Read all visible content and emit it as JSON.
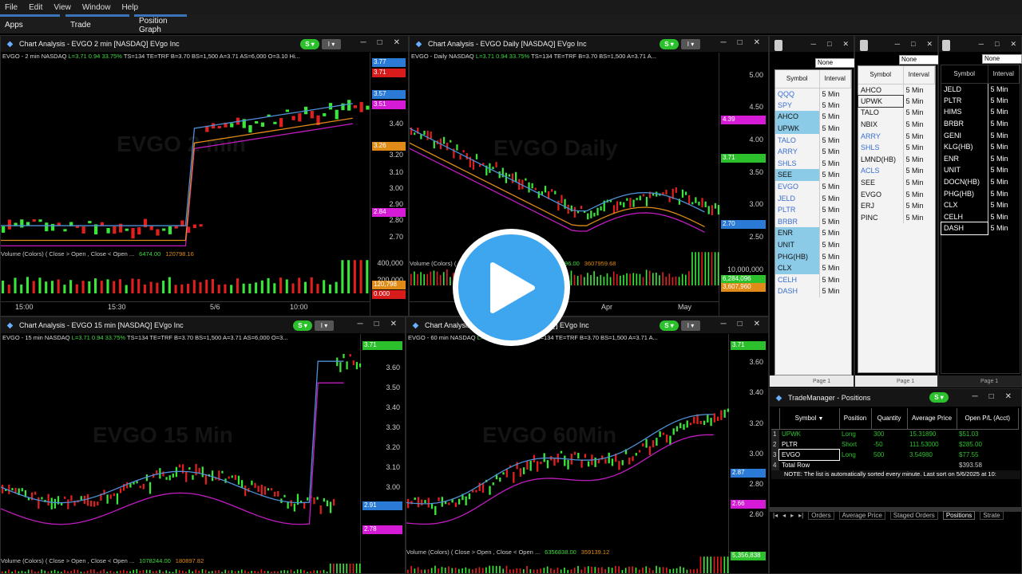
{
  "menu": [
    "File",
    "Edit",
    "View",
    "Window",
    "Help"
  ],
  "app_tabs": [
    "Apps",
    "Trade",
    "Position Graph"
  ],
  "chart1": {
    "title": "Chart Analysis - EVGO 2 min [NASDAQ] EVgo Inc",
    "info_pre": "EVGO - 2 min  NASDAQ  ",
    "info_last": "L=3.71  0.94  33.75%",
    "info_post": "  TS=134    TE=TRF          B=3.70  BS=1,500  A=3.71  AS=6,000  O=3.10  Hi...",
    "watermark": "EVGO 2 min",
    "axis_ticks": [
      "3.40",
      "3.20",
      "3.10",
      "3.00",
      "2.90",
      "2.80",
      "2.70"
    ],
    "tags": [
      {
        "text": "3.77",
        "color": "#2a7ad6"
      },
      {
        "text": "3.71",
        "color": "#d81b1b"
      },
      {
        "text": "3.57",
        "color": "#2a7ad6"
      },
      {
        "text": "3.51",
        "color": "#d61bd6"
      },
      {
        "text": "3.26",
        "color": "#e08a17"
      },
      {
        "text": "2.84",
        "color": "#d61bd6"
      }
    ],
    "vol_label": "Volume (Colors) ( Close > Open , Close < Open ...",
    "vol_v1": "6474.00",
    "vol_v2": "120798.16",
    "vol_ticks": [
      "400,000",
      "200,000"
    ],
    "vol_tags": [
      {
        "text": "120,798",
        "color": "#e08a17"
      },
      {
        "text": "0.000",
        "color": "#d81b1b"
      }
    ],
    "time_ticks": [
      "15:00",
      "15:30",
      "5/6",
      "10:00"
    ]
  },
  "chart2": {
    "title": "Chart Analysis - EVGO Daily [NASDAQ] EVgo Inc",
    "info_pre": "EVGO - Daily  NASDAQ  ",
    "info_last": "L=3.71  0.94  33.75%",
    "info_post": "  TS=134     TE=TRF          B=3.70  BS=1,500  A=3.71  A...",
    "watermark": "EVGO Daily",
    "axis_ticks": [
      "5.00",
      "4.50",
      "4.00",
      "3.50",
      "3.00",
      "2.50"
    ],
    "tags": [
      {
        "text": "4.39",
        "color": "#d61bd6"
      },
      {
        "text": "3.71",
        "color": "#2cc12c"
      },
      {
        "text": "2.70",
        "color": "#2a7ad6"
      }
    ],
    "vol_label": "Volume (Colors) ( Close > Open , Close < Open ...",
    "vol_v1": "6264096.00",
    "vol_v2": "3607959.68",
    "vol_ticks": [
      "10,000,000"
    ],
    "vol_tags": [
      {
        "text": "6,284,096",
        "color": "#2cc12c"
      },
      {
        "text": "3,607,960",
        "color": "#e08a17"
      }
    ],
    "time_ticks": [
      "Apr",
      "May"
    ]
  },
  "chart3": {
    "title": "Chart Analysis - EVGO 15 min [NASDAQ] EVgo Inc",
    "info_pre": "EVGO - 15 min  NASDAQ  ",
    "info_last": "L=3.71  0.94  33.75%",
    "info_post": "  TS=134    TE=TRF          B=3.70  BS=1,500  A=3.71  AS=6,000  O=3...",
    "watermark": "EVGO 15 Min",
    "axis_ticks": [
      "3.60",
      "3.50",
      "3.40",
      "3.30",
      "3.20",
      "3.10",
      "3.00"
    ],
    "tags": [
      {
        "text": "3.71",
        "color": "#2cc12c"
      },
      {
        "text": "2.91",
        "color": "#2a7ad6"
      },
      {
        "text": "2.78",
        "color": "#d61bd6"
      }
    ],
    "vol_label": "Volume (Colors) ( Close > Open , Close < Open ...",
    "vol_v1": "1078244.00",
    "vol_v2": "180897.82"
  },
  "chart4": {
    "title": "Chart Analysis - EVGO 60 min [NASDAQ] EVgo Inc",
    "info_pre": "EVGO - 60 min  NASDAQ  ",
    "info_last": "L=3.71  0.94  33.75%",
    "info_post": "  TS=134     TE=TRF          B=3.70  BS=1,500  A=3.71  A...",
    "watermark": "EVGO 60Min",
    "axis_ticks": [
      "3.60",
      "3.40",
      "3.20",
      "3.00",
      "2.80",
      "2.60"
    ],
    "tags": [
      {
        "text": "3.71",
        "color": "#2cc12c"
      },
      {
        "text": "2.87",
        "color": "#2a7ad6"
      },
      {
        "text": "2.66",
        "color": "#d61bd6"
      }
    ],
    "vol_label": "Volume (Colors) ( Close > Open , Close < Open ...",
    "vol_v1": "6356838.00",
    "vol_v2": "359139.12",
    "vol_tags": [
      {
        "text": "5,356,838",
        "color": "#2cc12c"
      }
    ]
  },
  "watchlists": [
    {
      "combo": "None",
      "col_symbol": "Symbol",
      "col_interval": "Interval",
      "rows": [
        {
          "s": "QQQ",
          "i": "5 Min",
          "hl": false,
          "c": "#3a6fd0"
        },
        {
          "s": "SPY",
          "i": "5 Min",
          "hl": false,
          "c": "#3a6fd0"
        },
        {
          "s": "AHCO",
          "i": "5 Min",
          "hl": true,
          "c": "#111"
        },
        {
          "s": "UPWK",
          "i": "5 Min",
          "hl": true,
          "c": "#111"
        },
        {
          "s": "TALO",
          "i": "5 Min",
          "hl": false,
          "c": "#3a6fd0"
        },
        {
          "s": "ARRY",
          "i": "5 Min",
          "hl": false,
          "c": "#3a6fd0"
        },
        {
          "s": "SHLS",
          "i": "5 Min",
          "hl": false,
          "c": "#3a6fd0"
        },
        {
          "s": "SEE",
          "i": "5 Min",
          "hl": true,
          "c": "#111"
        },
        {
          "s": "EVGO",
          "i": "5 Min",
          "hl": false,
          "c": "#3a6fd0"
        },
        {
          "s": "JELD",
          "i": "5 Min",
          "hl": false,
          "c": "#3a6fd0"
        },
        {
          "s": "PLTR",
          "i": "5 Min",
          "hl": false,
          "c": "#3a6fd0"
        },
        {
          "s": "BRBR",
          "i": "5 Min",
          "hl": false,
          "c": "#3a6fd0"
        },
        {
          "s": "ENR",
          "i": "5 Min",
          "hl": true,
          "c": "#111"
        },
        {
          "s": "UNIT",
          "i": "5 Min",
          "hl": true,
          "c": "#111"
        },
        {
          "s": "PHG(HB)",
          "i": "5 Min",
          "hl": true,
          "c": "#111"
        },
        {
          "s": "CLX",
          "i": "5 Min",
          "hl": true,
          "c": "#111"
        },
        {
          "s": "CELH",
          "i": "5 Min",
          "hl": false,
          "c": "#3a6fd0"
        },
        {
          "s": "DASH",
          "i": "5 Min",
          "hl": false,
          "c": "#3a6fd0"
        }
      ],
      "page": "Page 1"
    },
    {
      "combo": "None",
      "col_symbol": "Symbol",
      "col_interval": "Interval",
      "rows": [
        {
          "s": "AHCO",
          "i": "5 Min",
          "c": "#111"
        },
        {
          "s": "UPWK",
          "i": "5 Min",
          "c": "#111"
        },
        {
          "s": "TALO",
          "i": "5 Min",
          "c": "#111"
        },
        {
          "s": "NBIX",
          "i": "5 Min",
          "c": "#111"
        },
        {
          "s": "ARRY",
          "i": "5 Min",
          "c": "#3a6fd0"
        },
        {
          "s": "SHLS",
          "i": "5 Min",
          "c": "#3a6fd0"
        },
        {
          "s": "LMND(HB)",
          "i": "5 Min",
          "c": "#111"
        },
        {
          "s": "ACLS",
          "i": "5 Min",
          "c": "#3a6fd0"
        },
        {
          "s": "SEE",
          "i": "5 Min",
          "c": "#111"
        },
        {
          "s": "EVGO",
          "i": "5 Min",
          "c": "#111"
        },
        {
          "s": "ERJ",
          "i": "5 Min",
          "c": "#111"
        },
        {
          "s": "PINC",
          "i": "5 Min",
          "c": "#111"
        }
      ],
      "page": "Page 1"
    },
    {
      "combo": "None",
      "col_symbol": "Symbol",
      "col_interval": "Interval",
      "rows": [
        {
          "s": "JELD",
          "i": "5 Min"
        },
        {
          "s": "PLTR",
          "i": "5 Min"
        },
        {
          "s": "HIMS",
          "i": "5 Min"
        },
        {
          "s": "BRBR",
          "i": "5 Min"
        },
        {
          "s": "GENI",
          "i": "5 Min"
        },
        {
          "s": "KLG(HB)",
          "i": "5 Min"
        },
        {
          "s": "ENR",
          "i": "5 Min"
        },
        {
          "s": "UNIT",
          "i": "5 Min"
        },
        {
          "s": "DOCN(HB)",
          "i": "5 Min"
        },
        {
          "s": "PHG(HB)",
          "i": "5 Min"
        },
        {
          "s": "CLX",
          "i": "5 Min"
        },
        {
          "s": "CELH",
          "i": "5 Min"
        },
        {
          "s": "DASH",
          "i": "5 Min"
        }
      ],
      "page": "Page 1"
    }
  ],
  "trade_manager": {
    "title": "TradeManager - Positions",
    "columns": [
      "Symbol",
      "Position",
      "Quantity",
      "Average Price",
      "Open P/L (Acct)"
    ],
    "rows": [
      {
        "n": "1",
        "sym": "UPWK",
        "pos": "Long",
        "qty": "300",
        "avg": "15.31890",
        "pl": "$51.03",
        "color": "#2cc12c"
      },
      {
        "n": "2",
        "sym": "PLTR",
        "pos": "Short",
        "qty": "-50",
        "avg": "111.53000",
        "pl": "$285.00",
        "color": "#2cc12c"
      },
      {
        "n": "3",
        "sym": "EVGO",
        "pos": "Long",
        "qty": "500",
        "avg": "3.54980",
        "pl": "$77.55",
        "color": "#2cc12c"
      },
      {
        "n": "4",
        "sym": "Total Row",
        "pos": "",
        "qty": "",
        "avg": "",
        "pl": "$393.58",
        "color": "#ccc"
      }
    ],
    "note": "NOTE: The list is automatically sorted every minute. Last sort on 5/6/2025 at 10:",
    "tabs": [
      "Orders",
      "Average Price",
      "Staged Orders",
      "Positions",
      "Strate"
    ]
  },
  "colors": {
    "up": "#39e639",
    "down": "#e01f1f",
    "ma_blue": "#4f8fd6",
    "ma_magenta": "#c21bc2",
    "ma_orange": "#e08a17",
    "accent": "#3b74b8"
  }
}
